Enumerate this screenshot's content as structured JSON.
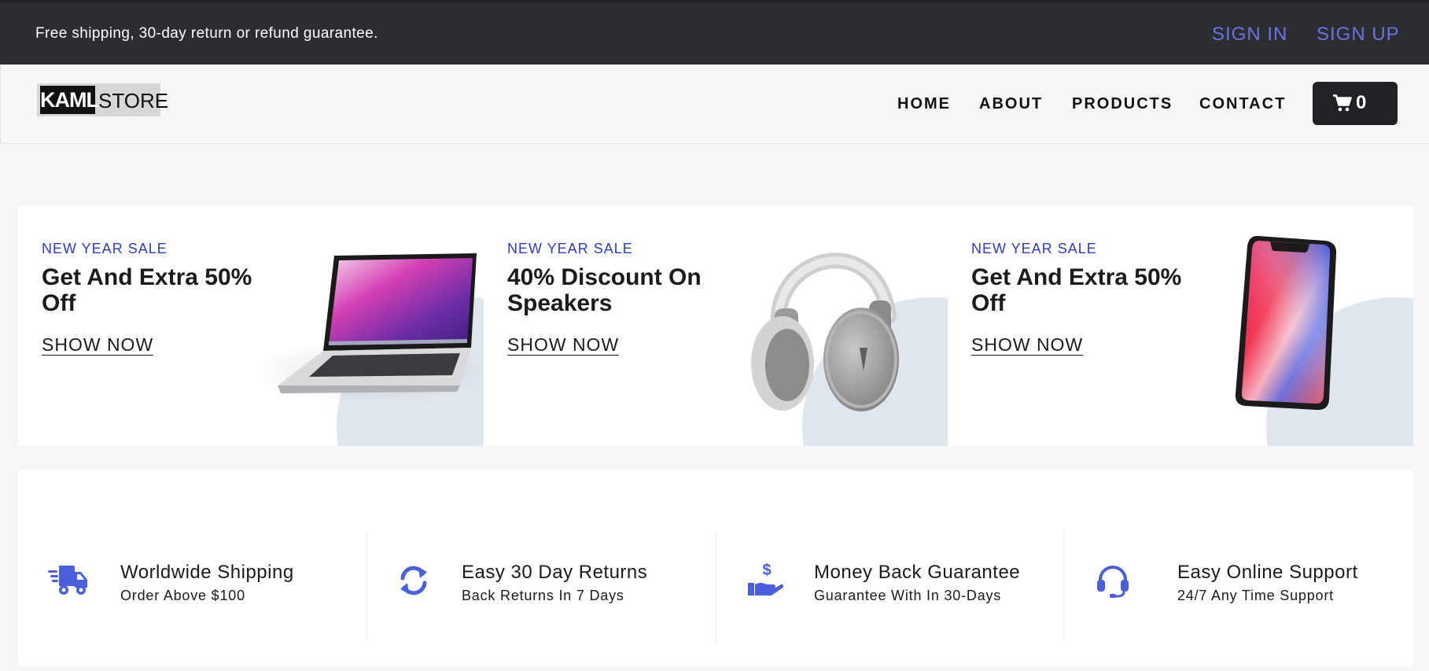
{
  "topbar": {
    "message": "Free shipping, 30-day return or refund guarantee.",
    "sign_in": "SIGN IN",
    "sign_up": "SIGN UP"
  },
  "logo": {
    "box": "KAML",
    "text": "STORE"
  },
  "nav": {
    "home": "HOME",
    "about": "ABOUT",
    "products": "PRODUCTS",
    "contact": "CONTACT",
    "cart_count": "0"
  },
  "promos": [
    {
      "tag": "NEW YEAR SALE",
      "title": "Get And Extra 50% Off",
      "link": "SHOW NOW",
      "image": "laptop"
    },
    {
      "tag": "NEW YEAR SALE",
      "title": "40% Discount On Speakers",
      "link": "SHOW NOW",
      "image": "headphones"
    },
    {
      "tag": "NEW YEAR SALE",
      "title": "Get And Extra 50% Off",
      "link": "SHOW NOW",
      "image": "smartphone"
    }
  ],
  "features": [
    {
      "icon": "truck-icon",
      "title": "Worldwide Shipping",
      "subtitle": "Order Above $100"
    },
    {
      "icon": "refresh-icon",
      "title": "Easy 30 Day Returns",
      "subtitle": "Back Returns In 7 Days"
    },
    {
      "icon": "money-hand-icon",
      "title": "Money Back Guarantee",
      "subtitle": "Guarantee With In 30-Days"
    },
    {
      "icon": "headset-icon",
      "title": "Easy Online Support",
      "subtitle": "24/7 Any Time Support"
    }
  ],
  "colors": {
    "topbar_bg": "#2c2d31",
    "link_accent": "#6a73e2",
    "promo_tag": "#2b3cc9",
    "feature_icon": "#4a5ee0"
  }
}
